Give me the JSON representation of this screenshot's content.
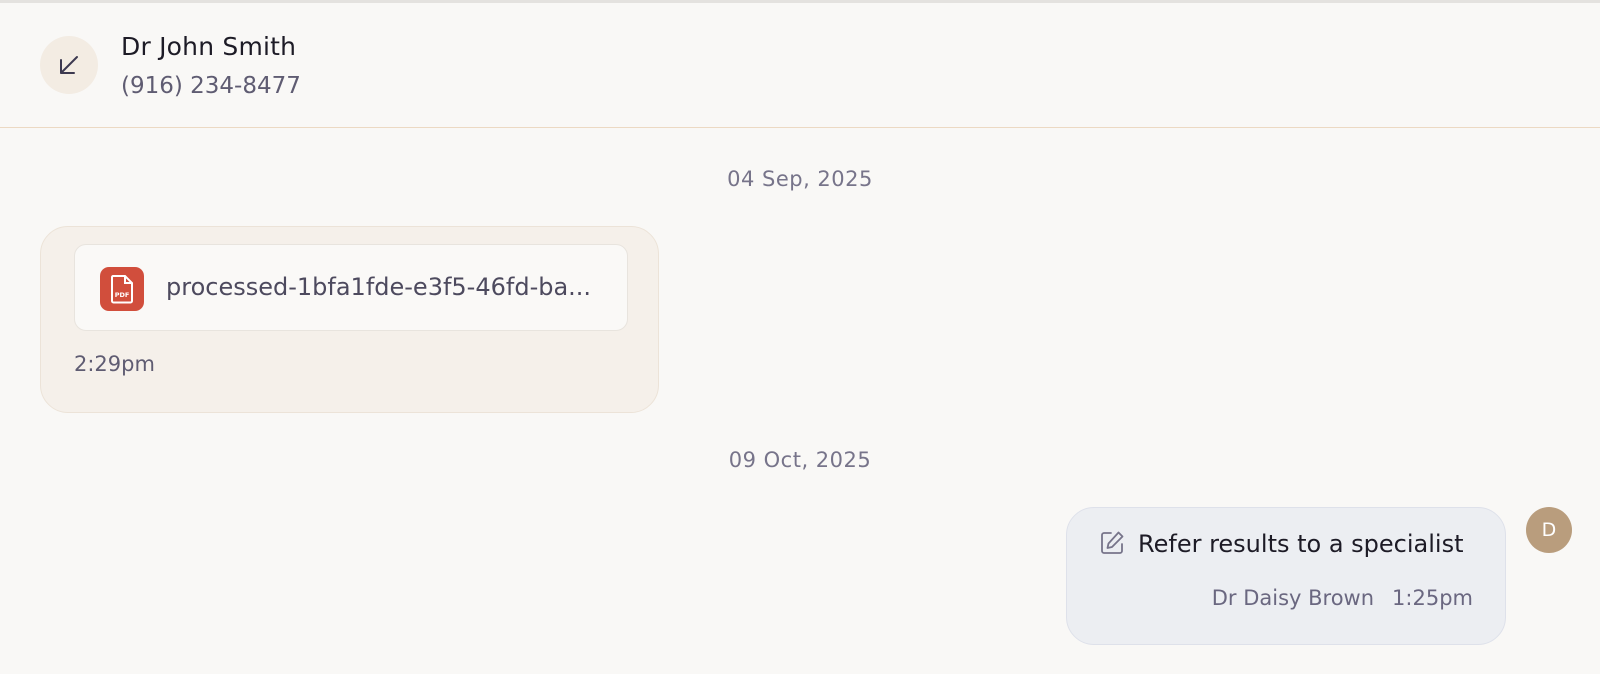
{
  "header": {
    "contact_name": "Dr John Smith",
    "contact_phone": "(916) 234-8477",
    "direction_icon": "arrow-down-left-icon"
  },
  "thread": {
    "groups": [
      {
        "date": "04 Sep, 2025",
        "message": {
          "direction": "incoming",
          "attachment": {
            "type": "pdf",
            "icon": "pdf-file-icon",
            "icon_label": "PDF",
            "file_name": "processed-1bfa1fde-e3f5-46fd-ba..."
          },
          "time": "2:29pm"
        }
      },
      {
        "date": "09 Oct, 2025",
        "message": {
          "direction": "outgoing",
          "icon": "note-edit-icon",
          "text": "Refer results to a specialist",
          "author": "Dr Daisy Brown",
          "time": "1:25pm",
          "avatar_initial": "D"
        }
      }
    ]
  },
  "colors": {
    "background": "#f9f8f6",
    "incoming_bubble": "#f5f0ea",
    "outgoing_bubble": "#eceef2",
    "pdf_red": "#d14e3c",
    "avatar": "#b99d7d",
    "header_divider": "#ecd9c3"
  }
}
